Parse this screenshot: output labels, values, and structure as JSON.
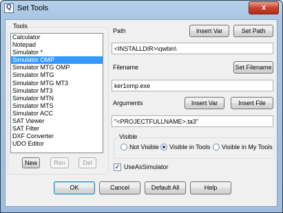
{
  "window": {
    "title": "Set Tools",
    "close_glyph": "x"
  },
  "tools": {
    "group_label": "Tools",
    "items": [
      "Calculator",
      "Notepad",
      "Simulator *",
      "Simulator OMP",
      "Simulator MTG OMP",
      "Simulator MTG",
      "Simulator MTG MT3",
      "Simulator MT3",
      "Simulator MTN",
      "Simulator MTS",
      "Simulator ACC",
      "SAT Viewer",
      "SAT Filter",
      "DXF Converter",
      "UDO Editor"
    ],
    "selected_index": 3,
    "new_label": "New",
    "ren_label": "Ren",
    "del_label": "Del"
  },
  "path": {
    "label": "Path",
    "value": "<INSTALLDIR>\\qwbin\\",
    "insert_var_label": "Insert Var",
    "set_path_label": "Set Path"
  },
  "filename": {
    "label": "Filename",
    "value": "ker1omp.exe",
    "set_filename_label": "Set Filename"
  },
  "arguments": {
    "label": "Arguments",
    "value": "\"<PROJECTFULLNAME>.ta3\"",
    "insert_var_label": "Insert Var",
    "insert_file_label": "Insert File"
  },
  "visible": {
    "group_label": "Visible",
    "options": [
      "Not Visible",
      "Visible in Tools",
      "Visible in My Tools"
    ],
    "selected_index": 1
  },
  "use_as_simulator": {
    "label": "UseAsSimulator",
    "checked": true,
    "check_glyph": "✓"
  },
  "footer": {
    "ok_label": "OK",
    "cancel_label": "Cancel",
    "default_all_label": "Default All",
    "help_label": "Help"
  }
}
